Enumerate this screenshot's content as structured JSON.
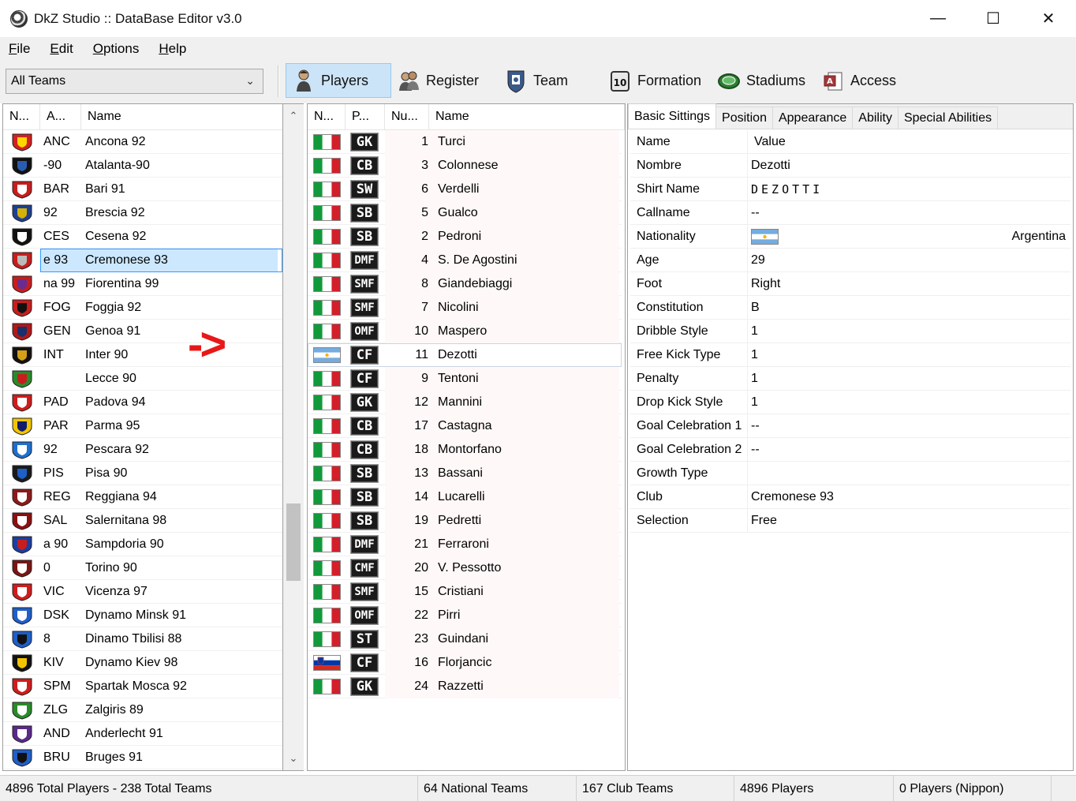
{
  "window": {
    "title": "DkZ Studio :: DataBase Editor v3.0",
    "controls": [
      "minimize",
      "maximize",
      "close"
    ]
  },
  "menu": [
    {
      "label": "File",
      "key": "F",
      "rest": "ile"
    },
    {
      "label": "Edit",
      "key": "E",
      "rest": "dit"
    },
    {
      "label": "Options",
      "key": "O",
      "rest": "ptions"
    },
    {
      "label": "Help",
      "key": "H",
      "rest": "elp"
    }
  ],
  "toolbar": {
    "team_filter": "All Teams",
    "buttons": [
      {
        "label": "Players",
        "icon": "player-icon",
        "active": true
      },
      {
        "label": "Register",
        "icon": "register-icon",
        "active": false
      },
      {
        "label": "Team",
        "icon": "team-badge-icon",
        "active": false
      },
      {
        "label": "Formation",
        "icon": "formation-icon",
        "active": false
      },
      {
        "label": "Stadiums",
        "icon": "stadium-icon",
        "active": false
      },
      {
        "label": "Access",
        "icon": "access-icon",
        "active": false
      }
    ]
  },
  "teams_list": {
    "columns": [
      "N...",
      "A...",
      "Name"
    ],
    "rows": [
      {
        "abbr": "ANC",
        "name": "Ancona 92",
        "colors": [
          "#d32020",
          "#ffd700"
        ]
      },
      {
        "abbr": "-90",
        "name": "Atalanta-90",
        "colors": [
          "#111111",
          "#2a5db0"
        ]
      },
      {
        "abbr": "BAR",
        "name": "Bari 91",
        "colors": [
          "#c81d1d",
          "#ffffff"
        ]
      },
      {
        "abbr": "92",
        "name": "Brescia 92",
        "colors": [
          "#1f3f8f",
          "#d4b106"
        ]
      },
      {
        "abbr": "CES",
        "name": "Cesena 92",
        "colors": [
          "#111111",
          "#ffffff"
        ]
      },
      {
        "abbr": "e 93",
        "name": "Cremonese 93",
        "colors": [
          "#c81d1d",
          "#bbbbbb"
        ],
        "selected": true
      },
      {
        "abbr": "na 99",
        "name": "Fiorentina 99",
        "colors": [
          "#c81d1d",
          "#6a2c91"
        ]
      },
      {
        "abbr": "FOG",
        "name": "Foggia 92",
        "colors": [
          "#c81d1d",
          "#111111"
        ]
      },
      {
        "abbr": "GEN",
        "name": "Genoa 91",
        "colors": [
          "#b01818",
          "#1a2f6b"
        ]
      },
      {
        "abbr": "INT",
        "name": "Inter 90",
        "colors": [
          "#111111",
          "#d4a017"
        ]
      },
      {
        "abbr": "",
        "name": "Lecce 90",
        "colors": [
          "#2a8a2a",
          "#c81d1d"
        ]
      },
      {
        "abbr": "PAD",
        "name": "Padova 94",
        "colors": [
          "#d01c1c",
          "#ffffff"
        ]
      },
      {
        "abbr": "PAR",
        "name": "Parma 95",
        "colors": [
          "#f2c500",
          "#111d6b"
        ]
      },
      {
        "abbr": "92",
        "name": "Pescara 92",
        "colors": [
          "#1e6fd0",
          "#ffffff"
        ]
      },
      {
        "abbr": "PIS",
        "name": "Pisa 90",
        "colors": [
          "#1a1a1a",
          "#1e5fc8"
        ]
      },
      {
        "abbr": "REG",
        "name": "Reggiana 94",
        "colors": [
          "#8b1a1a",
          "#ffffff"
        ]
      },
      {
        "abbr": "SAL",
        "name": "Salernitana 98",
        "colors": [
          "#8b1010",
          "#ffffff"
        ]
      },
      {
        "abbr": "a 90",
        "name": "Sampdoria 90",
        "colors": [
          "#1a3fa0",
          "#c81d1d"
        ]
      },
      {
        "abbr": "0",
        "name": "Torino 90",
        "colors": [
          "#7a1515",
          "#ffffff"
        ]
      },
      {
        "abbr": "VIC",
        "name": "Vicenza 97",
        "colors": [
          "#d01c1c",
          "#ffffff"
        ]
      },
      {
        "abbr": "DSK",
        "name": "Dynamo Minsk 91",
        "colors": [
          "#1e5fc8",
          "#ffffff"
        ]
      },
      {
        "abbr": "8",
        "name": "Dinamo Tbilisi 88",
        "colors": [
          "#1e5fc8",
          "#111111"
        ]
      },
      {
        "abbr": "KIV",
        "name": "Dynamo Kiev 98",
        "colors": [
          "#111111",
          "#f2c500"
        ]
      },
      {
        "abbr": "SPM",
        "name": "Spartak Mosca 92",
        "colors": [
          "#d01c1c",
          "#ffffff"
        ]
      },
      {
        "abbr": "ZLG",
        "name": "Zalgiris 89",
        "colors": [
          "#2a8a2a",
          "#ffffff"
        ]
      },
      {
        "abbr": "AND",
        "name": "Anderlecht 91",
        "colors": [
          "#5a2a8a",
          "#ffffff"
        ]
      },
      {
        "abbr": "BRU",
        "name": "Bruges 91",
        "colors": [
          "#1e5fc8",
          "#111111"
        ]
      }
    ]
  },
  "annotation": {
    "arrow_text": "->",
    "color": "#e81818"
  },
  "players_list": {
    "columns": [
      "N...",
      "P...",
      "Nu...",
      "Name"
    ],
    "rows": [
      {
        "flag": "italy",
        "pos": "GK",
        "num": "1",
        "name": "Turci"
      },
      {
        "flag": "italy",
        "pos": "CB",
        "num": "3",
        "name": "Colonnese"
      },
      {
        "flag": "italy",
        "pos": "SW",
        "num": "6",
        "name": "Verdelli"
      },
      {
        "flag": "italy",
        "pos": "SB",
        "num": "5",
        "name": "Gualco"
      },
      {
        "flag": "italy",
        "pos": "SB",
        "num": "2",
        "name": "Pedroni"
      },
      {
        "flag": "italy",
        "pos": "DMF",
        "num": "4",
        "name": "S. De Agostini"
      },
      {
        "flag": "italy",
        "pos": "SMF",
        "num": "8",
        "name": "Giandebiaggi"
      },
      {
        "flag": "italy",
        "pos": "SMF",
        "num": "7",
        "name": "Nicolini"
      },
      {
        "flag": "italy",
        "pos": "OMF",
        "num": "10",
        "name": "Maspero"
      },
      {
        "flag": "argentina",
        "pos": "CF",
        "num": "11",
        "name": "Dezotti",
        "selected": true
      },
      {
        "flag": "italy",
        "pos": "CF",
        "num": "9",
        "name": "Tentoni"
      },
      {
        "flag": "italy",
        "pos": "GK",
        "num": "12",
        "name": "Mannini"
      },
      {
        "flag": "italy",
        "pos": "CB",
        "num": "17",
        "name": "Castagna"
      },
      {
        "flag": "italy",
        "pos": "CB",
        "num": "18",
        "name": "Montorfano"
      },
      {
        "flag": "italy",
        "pos": "SB",
        "num": "13",
        "name": "Bassani"
      },
      {
        "flag": "italy",
        "pos": "SB",
        "num": "14",
        "name": "Lucarelli"
      },
      {
        "flag": "italy",
        "pos": "SB",
        "num": "19",
        "name": "Pedretti"
      },
      {
        "flag": "italy",
        "pos": "DMF",
        "num": "21",
        "name": "Ferraroni"
      },
      {
        "flag": "italy",
        "pos": "CMF",
        "num": "20",
        "name": "V. Pessotto"
      },
      {
        "flag": "italy",
        "pos": "SMF",
        "num": "15",
        "name": "Cristiani"
      },
      {
        "flag": "italy",
        "pos": "OMF",
        "num": "22",
        "name": "Pirri"
      },
      {
        "flag": "italy",
        "pos": "ST",
        "num": "23",
        "name": "Guindani"
      },
      {
        "flag": "slovenia",
        "pos": "CF",
        "num": "16",
        "name": "Florjancic"
      },
      {
        "flag": "italy",
        "pos": "GK",
        "num": "24",
        "name": "Razzetti"
      }
    ]
  },
  "details": {
    "tabs": [
      "Basic Sittings",
      "Position",
      "Appearance",
      "Ability",
      "Special Abilities"
    ],
    "header": {
      "key": "Name",
      "value": "Value"
    },
    "rows": [
      {
        "key": "Nombre",
        "value": "Dezotti"
      },
      {
        "key": "Shirt Name",
        "value": "DEZOTTI",
        "spaced": true
      },
      {
        "key": "Callname",
        "value": "--"
      },
      {
        "key": "Nationality",
        "value": "Argentina",
        "flag": "argentina"
      },
      {
        "key": "Age",
        "value": "29"
      },
      {
        "key": "Foot",
        "value": "Right"
      },
      {
        "key": "Constitution",
        "value": "B"
      },
      {
        "key": "Dribble Style",
        "value": "1"
      },
      {
        "key": "Free Kick Type",
        "value": "1"
      },
      {
        "key": "Penalty",
        "value": "1"
      },
      {
        "key": "Drop Kick Style",
        "value": "1"
      },
      {
        "key": "Goal Celebration 1",
        "value": "--"
      },
      {
        "key": "Goal Celebration 2",
        "value": "--"
      },
      {
        "key": "Growth Type",
        "value": ""
      },
      {
        "key": "Club",
        "value": "Cremonese 93"
      },
      {
        "key": "Selection",
        "value": "Free"
      }
    ]
  },
  "status": [
    "4896 Total Players  -  238 Total Teams",
    "64 National Teams",
    "167 Club Teams",
    "4896 Players",
    "0 Players (Nippon)"
  ]
}
